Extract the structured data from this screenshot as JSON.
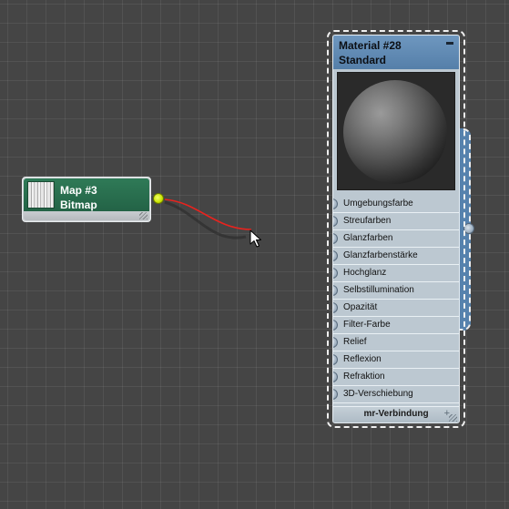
{
  "bitmap_node": {
    "title": "Map #3",
    "subtitle": "Bitmap",
    "header_color": "#2f7a57",
    "output_socket_color": "#c9e400"
  },
  "material_node": {
    "title": "Material #28",
    "subtitle": "Standard",
    "header_color": "#6e97bf",
    "slots": [
      "Umgebungsfarbe",
      "Streufarben",
      "Glanzfarben",
      "Glanzfarbenstärke",
      "Hochglanz",
      "Selbstillumination",
      "Opazität",
      "Filter-Farbe",
      "Relief",
      "Reflexion",
      "Refraktion",
      "3D-Verschiebung"
    ],
    "footer_label": "mr-Verbindung",
    "footer_plus": "+"
  },
  "wire_color": "#e8231e",
  "icons": {
    "collapse": "minus-icon",
    "cursor": "arrow-cursor-icon",
    "resize": "resize-grip-icon"
  }
}
